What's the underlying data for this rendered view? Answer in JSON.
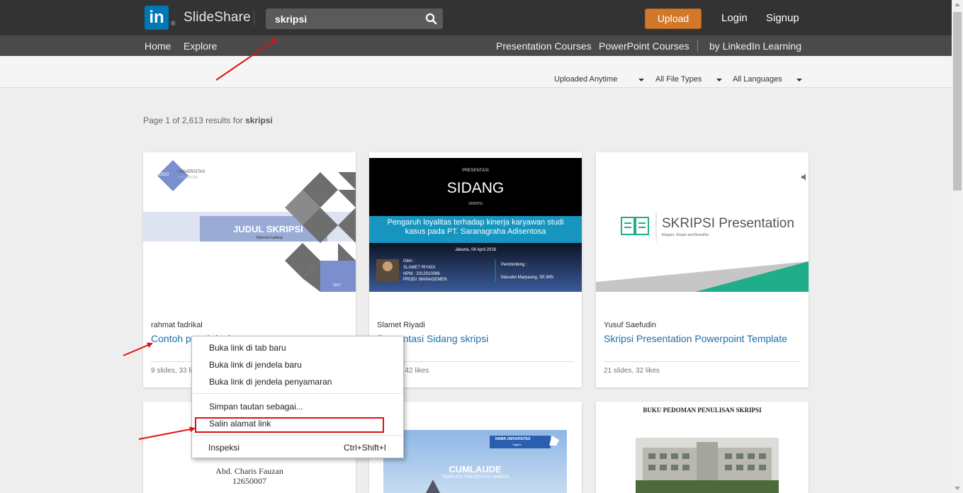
{
  "header": {
    "logo_mark": "in",
    "logo_registered": "®",
    "brand": "SlideShare",
    "search_value": "skripsi",
    "upload_label": "Upload",
    "login_label": "Login",
    "signup_label": "Signup"
  },
  "nav": {
    "home": "Home",
    "explore": "Explore",
    "presentation_courses": "Presentation Courses",
    "powerpoint_courses": "PowerPoint Courses",
    "linkedin_learning": "by LinkedIn Learning"
  },
  "filters": {
    "uploaded": "Uploaded Anytime",
    "file_types": "All File Types",
    "languages": "All Languages"
  },
  "results": {
    "prefix": "Page 1 of 2,613 results for ",
    "query": "skripsi"
  },
  "cards": [
    {
      "author": "rahmat fadrikal",
      "title": "Contoh ppt skripsi",
      "meta": "9 slides, 33 likes",
      "thumb": {
        "logo": "LOGO",
        "univ": "UNIVERSITAS",
        "univ_sub": "NAMA KOTA",
        "heading": "JUDUL SKRIPSI",
        "sub": "Rahmat Fadrikal",
        "year": "2017"
      }
    },
    {
      "author": "Slamet Riyadi",
      "title": "Presentasi Sidang skripsi",
      "meta": "6 slides, 42 likes",
      "thumb": {
        "top": "PRESENTASI",
        "heading": "SIDANG",
        "sub": "SKRIPSI",
        "band": "Pengaruh loyalitas terhadap kinerja karyawan studi kasus pada PT. Saranagraha Adisentosa",
        "date": "Jakarta, 08 April 2016",
        "oleh": "Oleh :",
        "name": "SLAMET  RIYADI",
        "npm": "NPM    : 2012010096",
        "prodi": "PRODI  :MANAGEMEN",
        "pembimbing": "Pembimbing :",
        "pembimbing_name": "Marudut Marpaung, SE.MSi"
      }
    },
    {
      "author": "Yusuf Saefudin",
      "title": "Skripsi Presentation Powerpoint Template",
      "meta": "21 slides, 32 likes",
      "thumb": {
        "heading": "SKRIPSI Presentation",
        "sub": "Elegant, Simple and Beautiful."
      }
    }
  ],
  "row2": {
    "card1_name": "Abd. Charis Fauzan",
    "card1_id": "12650007",
    "card2_univ": "NAMA UNIVERSITAS",
    "card2_univ_sub": "Tagline",
    "card2_heading": "CUMLAUDE",
    "card2_sub": "TEMPLATE PRESENTASI SKRIPSI",
    "card3_heading": "BUKU PEDOMAN PENULISAN SKRIPSI"
  },
  "context_menu": {
    "open_tab": "Buka link di tab baru",
    "open_window": "Buka link di jendela baru",
    "open_incognito": "Buka link di jendela penyamaran",
    "save_link": "Simpan tautan sebagai...",
    "copy_link": "Salin alamat link",
    "inspect": "Inspeksi",
    "inspect_shortcut": "Ctrl+Shift+I"
  },
  "colors": {
    "topbar": "#333333",
    "linkedin_blue": "#0077b5",
    "upload_orange": "#d2782a",
    "link_blue": "#1a6ea8",
    "annotation_red": "#e01010"
  }
}
